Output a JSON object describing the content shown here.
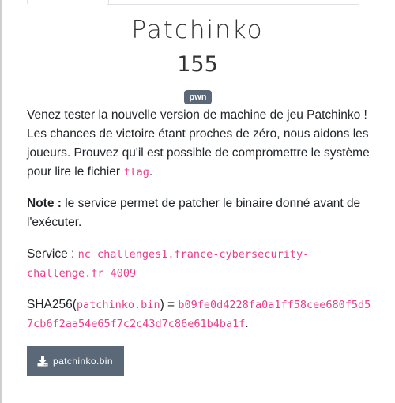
{
  "challenge": {
    "title": "Patchinko",
    "points": "155",
    "category": "pwn"
  },
  "description": {
    "intro": "Venez tester la nouvelle version de machine de jeu Patchinko ! Les chances de victoire étant proches de zéro, nous aidons les joueurs. Prouvez qu'il est possible de compromettre le système pour lire le fichier ",
    "flag_file": "flag",
    "intro_end": ".",
    "note_label": "Note :",
    "note_text": " le service permet de patcher le binaire donné avant de l'exécuter.",
    "service_label": "Service : ",
    "service_command": "nc challenges1.france-cybersecurity-challenge.fr 4009",
    "sha_prefix": "SHA256(",
    "sha_filename": "patchinko.bin",
    "sha_middle": ") = ",
    "sha_value": "b09fe0d4228fa0a1ff58cee680f5d57cb6f2aa54e65f7c2c43d7c86e61b4ba1f",
    "sha_end": "."
  },
  "download": {
    "label": "patchinko.bin",
    "icon": "download-icon"
  },
  "colors": {
    "badge_bg": "#5a6878",
    "code_pink": "#e83e8c",
    "button_bg": "#5a6878"
  }
}
